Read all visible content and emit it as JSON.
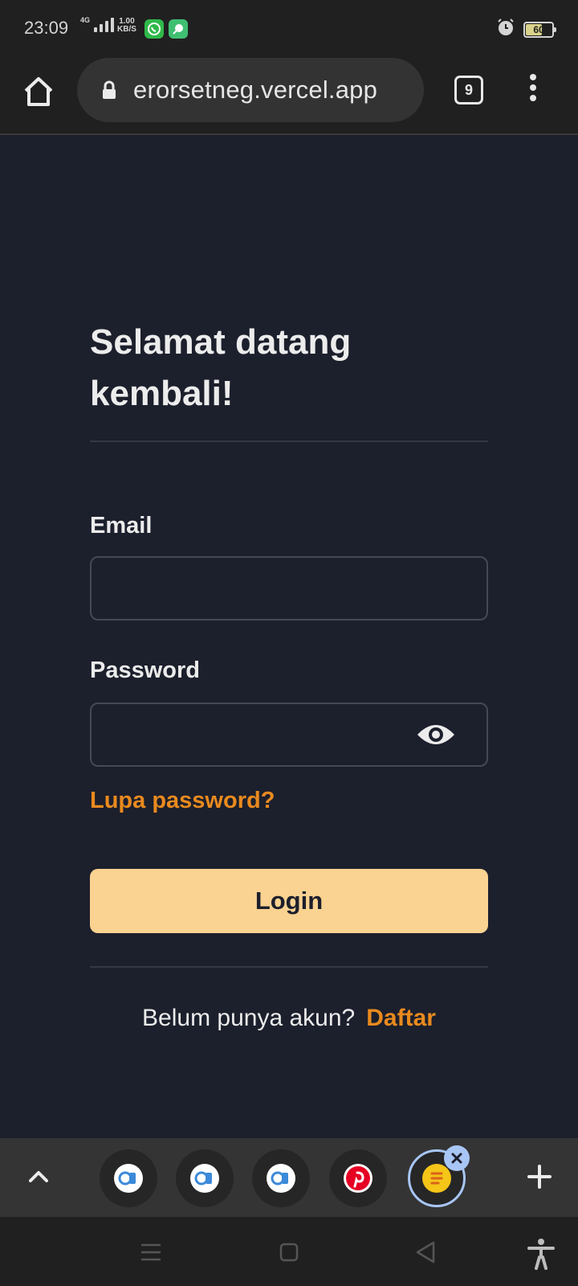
{
  "status_bar": {
    "time": "23:09",
    "network_type": "4G",
    "speed_value": "1.00",
    "speed_unit": "KB/S",
    "battery": "60",
    "icons": [
      "whatsapp-icon",
      "app-notification-icon",
      "alarm-icon"
    ]
  },
  "browser": {
    "url": "erorsetneg.vercel.app",
    "tab_count": "9"
  },
  "login": {
    "title": "Selamat datang kembali!",
    "email_label": "Email",
    "email_value": "",
    "password_label": "Password",
    "password_value": "",
    "forgot_link": "Lupa password?",
    "login_button": "Login",
    "signup_prompt": "Belum punya akun?",
    "signup_link": "Daftar"
  },
  "tab_strip": {
    "tabs": [
      {
        "icon": "site-favicon-icon",
        "active": false
      },
      {
        "icon": "site-favicon-icon",
        "active": false
      },
      {
        "icon": "site-favicon-icon",
        "active": false
      },
      {
        "icon": "pinterest-icon",
        "active": false
      },
      {
        "icon": "yellow-app-icon",
        "active": true
      }
    ]
  },
  "colors": {
    "page_background": "#1c1f2c",
    "accent_orange": "#e98a1e",
    "login_button": "#fad291",
    "active_tab_ring": "#a8c6f5"
  }
}
